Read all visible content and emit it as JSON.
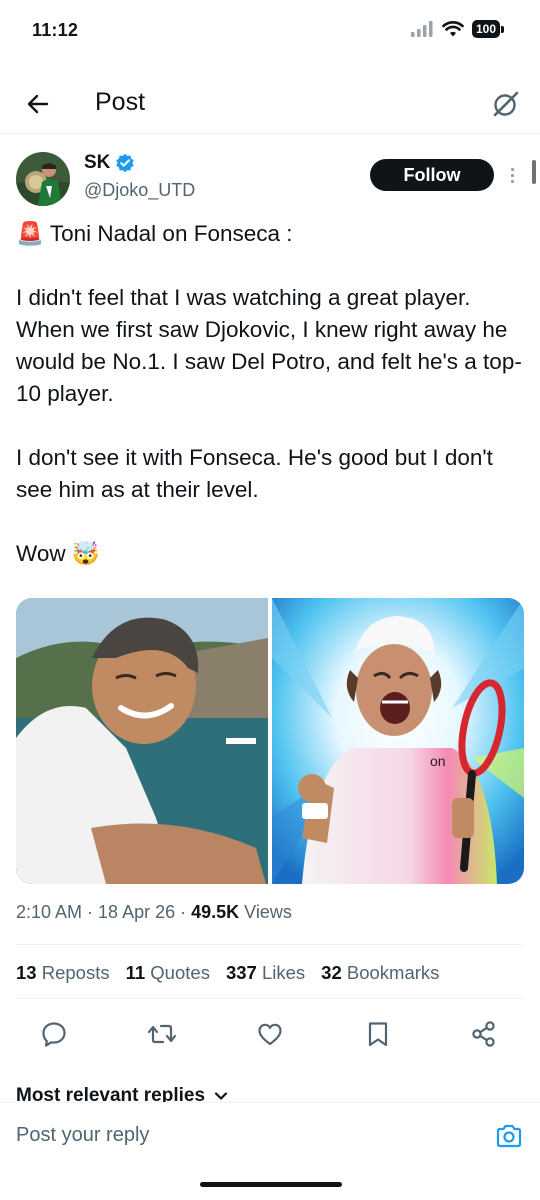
{
  "status_bar": {
    "time": "11:12",
    "battery": "100"
  },
  "header": {
    "title": "Post",
    "back_icon": "arrow-left-icon",
    "grok_icon": "grok-slash-icon"
  },
  "author": {
    "name": "SK",
    "handle": "@Djoko_UTD",
    "verified": true,
    "follow_label": "Follow"
  },
  "tweet": {
    "lines": [
      "🚨 Toni Nadal on Fonseca :",
      "",
      "I didn't feel that I was watching a great player. When we first saw Djokovic, I knew right away he would be No.1. I saw Del Potro, and felt he's a top-10 player.",
      "",
      "I don't see it with Fonseca. He's good but I don't see him as at their level.",
      "",
      "Wow 🤯"
    ]
  },
  "meta": {
    "time": "2:10 AM",
    "sep1": "·",
    "date": "18 Apr 26",
    "sep2": "·",
    "views_count": "49.5K",
    "views_label": "Views"
  },
  "stats": [
    {
      "count": "13",
      "label": "Reposts"
    },
    {
      "count": "11",
      "label": "Quotes"
    },
    {
      "count": "337",
      "label": "Likes"
    },
    {
      "count": "32",
      "label": "Bookmarks"
    }
  ],
  "actions": [
    {
      "name": "reply-icon"
    },
    {
      "name": "repost-icon"
    },
    {
      "name": "like-icon"
    },
    {
      "name": "bookmark-icon"
    },
    {
      "name": "share-icon"
    }
  ],
  "replies": {
    "header": "Most relevant replies"
  },
  "reply_bar": {
    "placeholder": "Post your reply"
  },
  "colors": {
    "text": "#0f1419",
    "secondary": "#536471",
    "verified": "#1d9bf0",
    "divider": "#eff3f4"
  }
}
